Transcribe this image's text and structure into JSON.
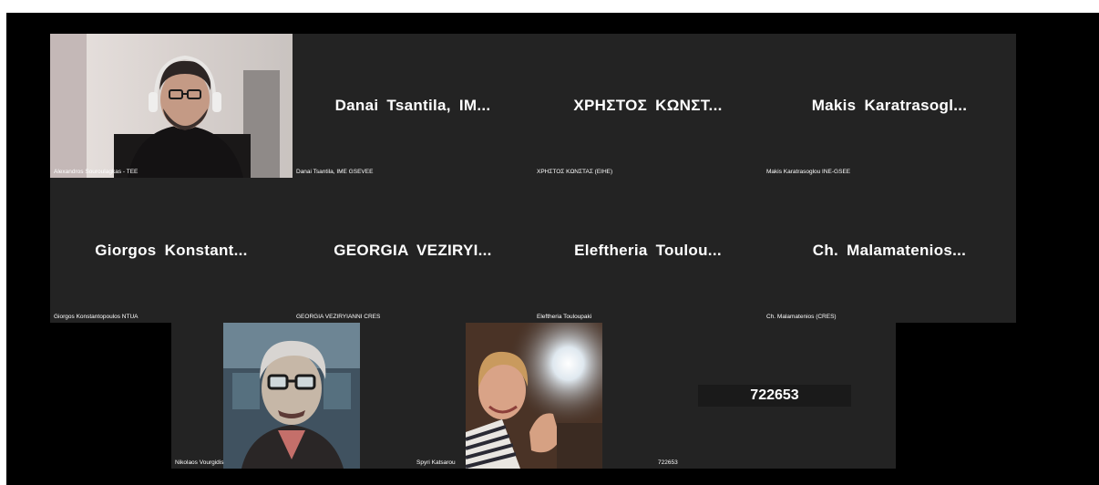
{
  "participants": {
    "row1": [
      {
        "video": "webcam",
        "label": "Alexandros Souroulagkas - TEE"
      },
      {
        "big": "Danai Tsantila, IM...",
        "label": "Danai Tsantila, IME GSEVEE"
      },
      {
        "big": "ΧΡΗΣΤΟΣ ΚΩΝΣΤ...",
        "label": "ΧΡΗΣΤΟΣ ΚΩΝΣΤΑΣ (ΕΙΗΕ)"
      },
      {
        "big": "Makis Karatrasogl...",
        "label": "Makis Karatrasoglou INE-GSEE"
      }
    ],
    "row2": [
      {
        "big": "Giorgos Konstant...",
        "label": "Giorgos Konstantopoulos NTUA"
      },
      {
        "big": "GEORGIA VEZIRYI...",
        "label": "GEORGIA VEZIRYIANNI CRES"
      },
      {
        "big": "Eleftheria Toulou...",
        "label": "Eleftheria Touloupaki"
      },
      {
        "big": "Ch. Malamatenios...",
        "label": "Ch. Malamatenios (CRES)"
      }
    ],
    "row3": [
      {
        "video": "cartoon-avatar",
        "label": "Nikolaos Vourgidis"
      },
      {
        "video": "selfie-webcam",
        "label": "Spyri Katsarou"
      },
      {
        "big": "722653",
        "label": "722653"
      }
    ]
  }
}
